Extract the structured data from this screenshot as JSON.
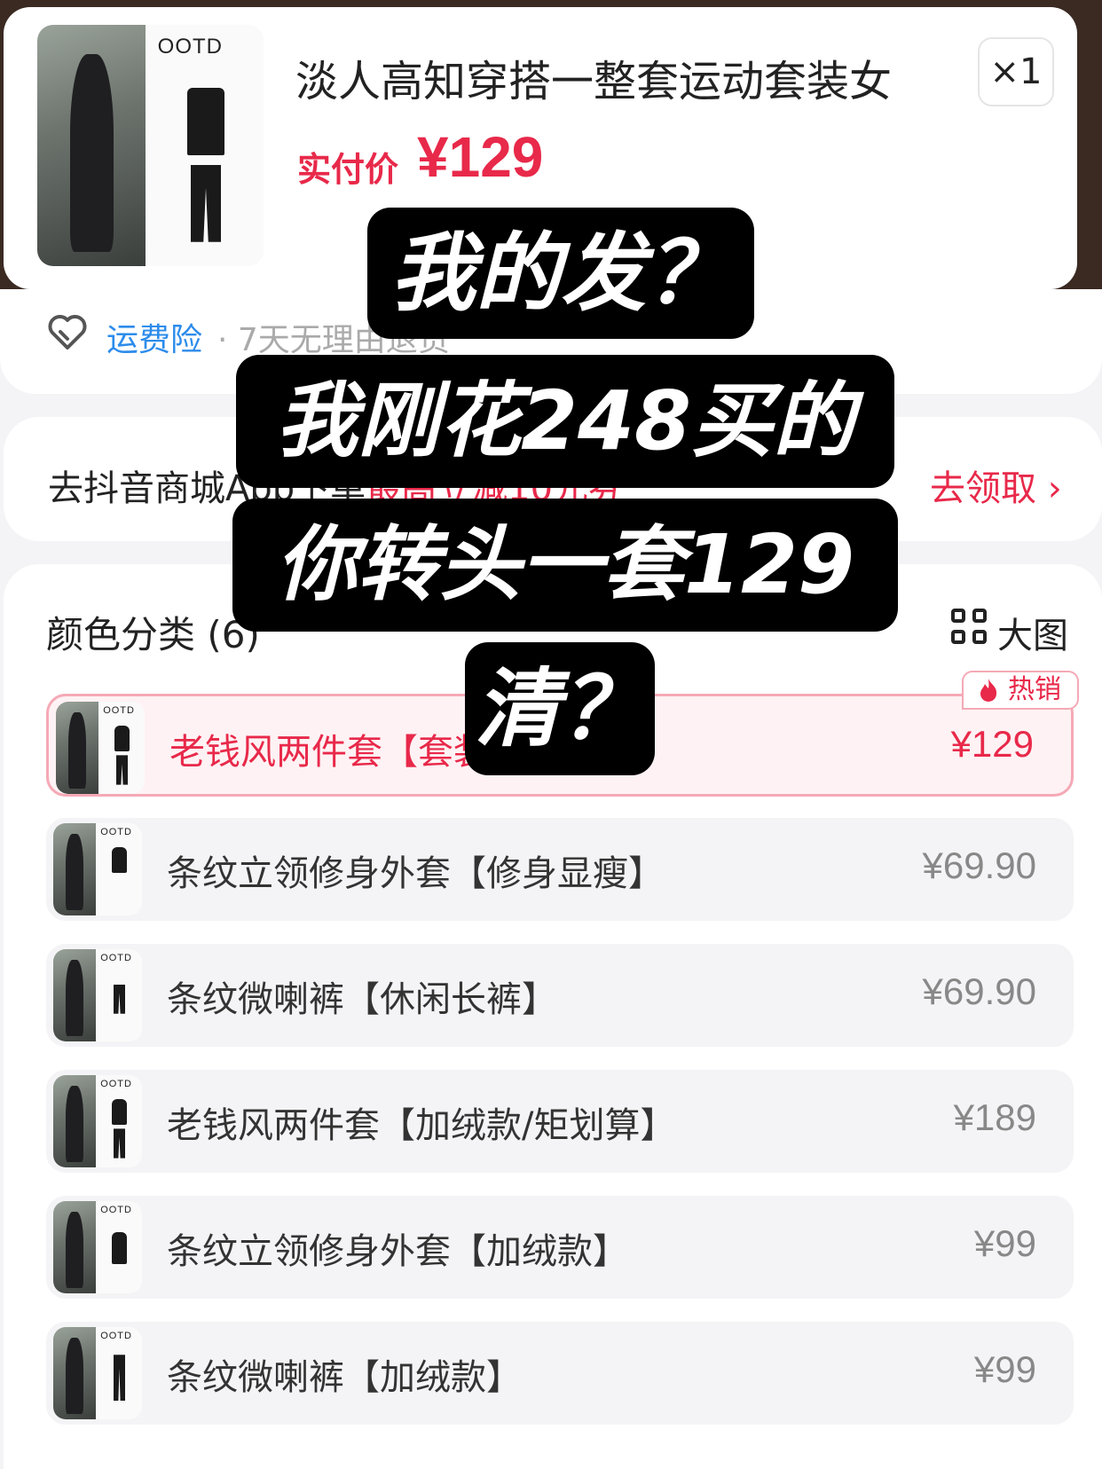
{
  "product": {
    "title": "淡人高知穿搭一整套运动套装女",
    "quantity": "×1",
    "pay_label": "实付价",
    "pay_price": "¥129",
    "thumb_brand": "OOTD"
  },
  "insurance": {
    "label": "运费险",
    "sub": "· 7天无理由退货"
  },
  "coupon": {
    "text_prefix": "去抖音商城App下单",
    "text_highlight": "最高立减10元券",
    "action": "去领取 ›"
  },
  "sku": {
    "title": "颜色分类 (6)",
    "view_toggle": "大图",
    "hot_badge": "热销",
    "items": [
      {
        "name": "老钱风两件套【套装】",
        "price": "¥129",
        "brand": "OOTD"
      },
      {
        "name": "条纹立领修身外套【修身显瘦】",
        "price": "¥69.90",
        "brand": "OOTD"
      },
      {
        "name": "条纹微喇裤【休闲长裤】",
        "price": "¥69.90",
        "brand": "OOTD"
      },
      {
        "name": "老钱风两件套【加绒款/矩划算】",
        "price": "¥189",
        "brand": "OOTD"
      },
      {
        "name": "条纹立领修身外套【加绒款】",
        "price": "¥99",
        "brand": "OOTD"
      },
      {
        "name": "条纹微喇裤【加绒款】",
        "price": "¥99",
        "brand": "OOTD"
      }
    ]
  },
  "caption": {
    "line1": "我的发？",
    "line2": "我刚花248买的",
    "line3": "你转头一套129",
    "line4": "清？"
  },
  "colors": {
    "accent_red": "#e8294a",
    "link_blue": "#2d8ceb",
    "selected_border": "#f5a9b6"
  }
}
